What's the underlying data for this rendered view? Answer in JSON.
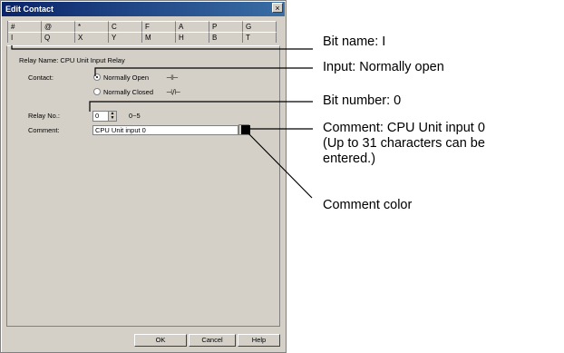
{
  "window": {
    "title": "Edit Contact",
    "close_glyph": "×"
  },
  "tabs": {
    "row1": [
      "#",
      "@",
      "*",
      "C",
      "F",
      "A",
      "P",
      "G"
    ],
    "row2": [
      "I",
      "Q",
      "X",
      "Y",
      "M",
      "H",
      "B",
      "T"
    ]
  },
  "relay_name": "Relay Name:  CPU Unit Input Relay",
  "contact": {
    "label": "Contact:",
    "option1": "Normally Open",
    "option2": "Normally Closed",
    "symbol1": "⊣⊢",
    "symbol2": "⊣/⊢",
    "selected": "Normally Open"
  },
  "relay_no": {
    "label": "Relay No.:",
    "value": "0",
    "range": "0~5"
  },
  "comment": {
    "label": "Comment:",
    "value": "CPU Unit input 0",
    "color": "#000000"
  },
  "buttons": {
    "ok": "OK",
    "cancel": "Cancel",
    "help": "Help"
  },
  "callouts": {
    "bit_name": "Bit name: I",
    "input": "Input: Normally open",
    "bit_number": "Bit number: 0",
    "comment_line1": "Comment: CPU Unit input 0",
    "comment_line2": "(Up to 31 characters can be",
    "comment_line3": "entered.)",
    "comment_color": "Comment color"
  }
}
